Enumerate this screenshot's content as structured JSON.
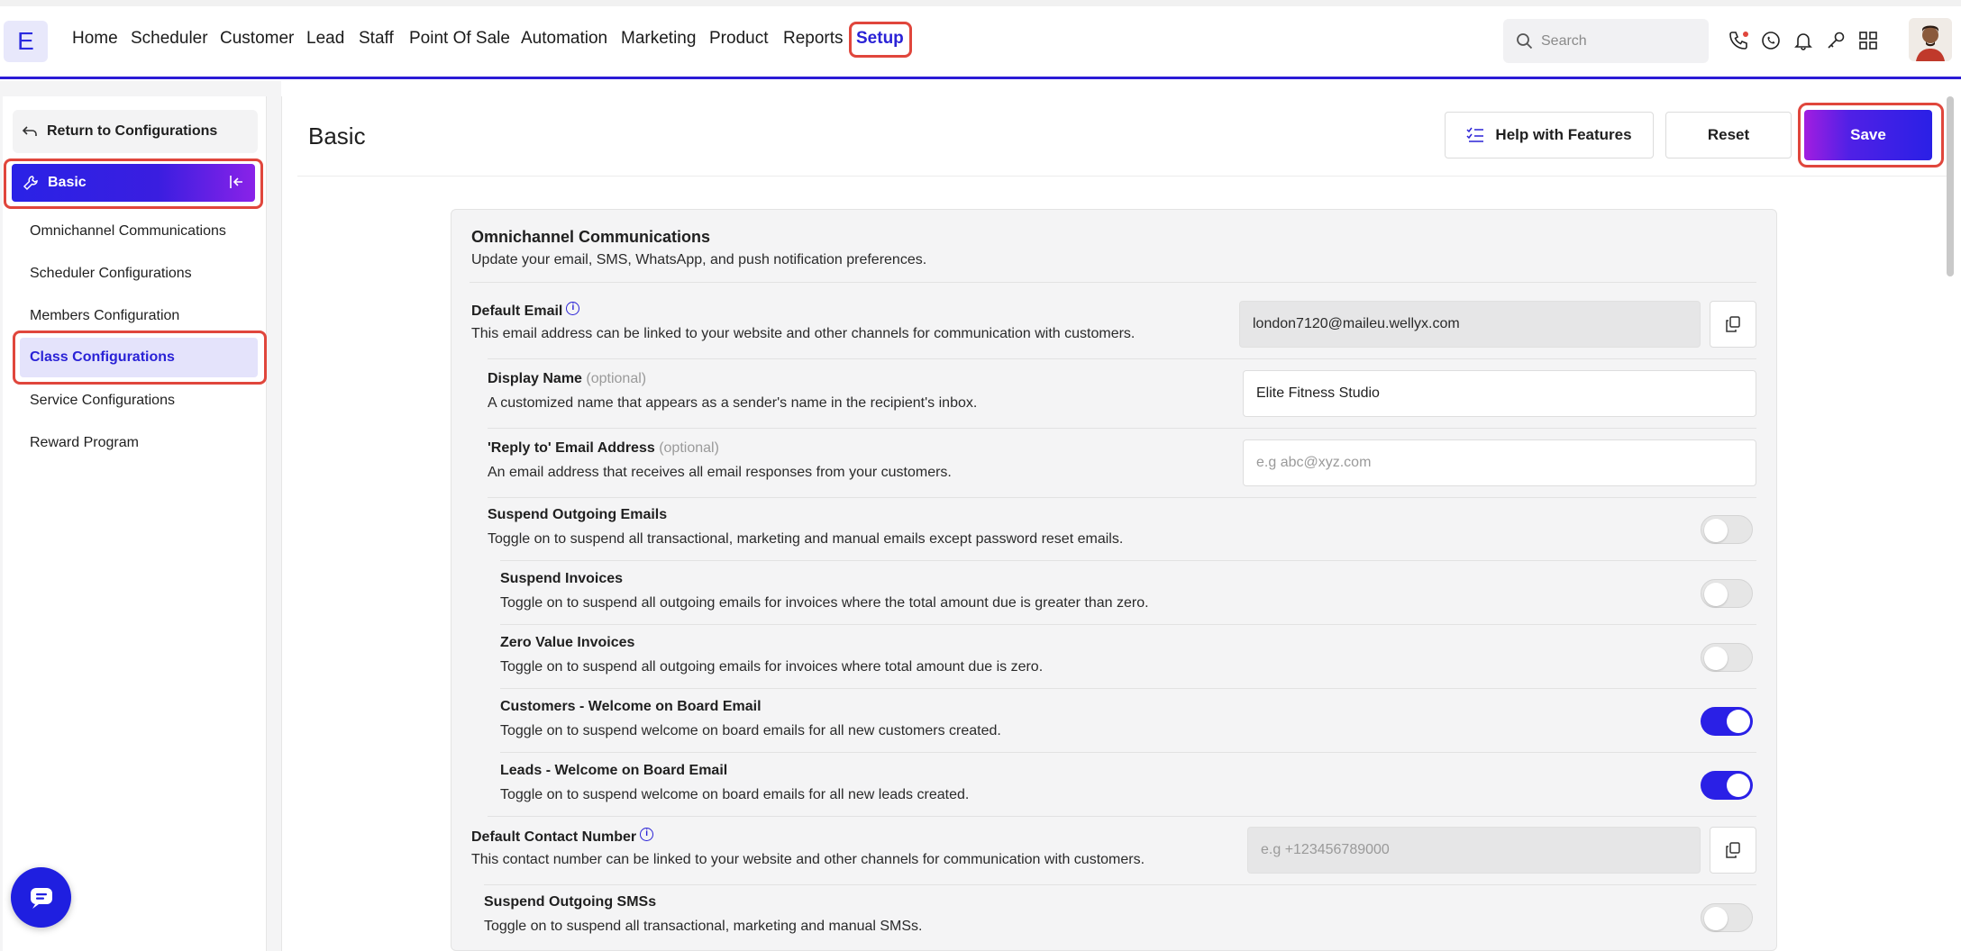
{
  "nav": {
    "logo": "E",
    "items": [
      "Home",
      "Scheduler",
      "Customer",
      "Lead",
      "Staff",
      "Point Of Sale",
      "Automation",
      "Marketing",
      "Product",
      "Reports",
      "Setup"
    ],
    "active": "Setup",
    "search_placeholder": "Search",
    "icons": [
      "phone-icon",
      "whatsapp-icon",
      "bell-icon",
      "key-icon",
      "grid-icon"
    ]
  },
  "sidebar": {
    "return_label": "Return to Configurations",
    "section_label": "Basic",
    "items": [
      "Omnichannel Communications",
      "Scheduler Configurations",
      "Members Configuration",
      "Class Configurations",
      "Service Configurations",
      "Reward Program"
    ],
    "selected_item": "Class Configurations"
  },
  "header": {
    "title": "Basic",
    "help_label": "Help with Features",
    "reset_label": "Reset",
    "save_label": "Save"
  },
  "card": {
    "title": "Omnichannel Communications",
    "subtitle": "Update your email, SMS, WhatsApp, and push notification preferences.",
    "default_email": {
      "title": "Default Email",
      "desc": "This email address can be linked to your website and other channels for communication with customers.",
      "value": "london7120@maileu.wellyx.com"
    },
    "display_name": {
      "title": "Display Name",
      "optional": "(optional)",
      "desc": "A customized name that appears as a sender's name in the recipient's inbox.",
      "value": "Elite Fitness Studio"
    },
    "reply_to": {
      "title": "'Reply to' Email Address",
      "optional": "(optional)",
      "desc": "An email address that receives all email responses from your customers.",
      "placeholder": "e.g abc@xyz.com"
    },
    "toggles": [
      {
        "title": "Suspend Outgoing Emails",
        "desc": "Toggle on to suspend all transactional, marketing and manual emails except password reset emails.",
        "on": false
      },
      {
        "title": "Suspend Invoices",
        "desc": "Toggle on to suspend all outgoing emails for invoices where the total amount due is greater than zero.",
        "on": false
      },
      {
        "title": "Zero Value Invoices",
        "desc": "Toggle on to suspend all outgoing emails for invoices where total amount due is zero.",
        "on": false
      },
      {
        "title": "Customers - Welcome on Board Email",
        "desc": "Toggle on to suspend welcome on board emails for all new customers created.",
        "on": true
      },
      {
        "title": "Leads - Welcome on Board Email",
        "desc": "Toggle on to suspend welcome on board emails for all new leads created.",
        "on": true
      }
    ],
    "default_contact": {
      "title": "Default Contact Number",
      "desc": "This contact number can be linked to your website and other channels for communication with customers.",
      "placeholder": "e.g +123456789000"
    },
    "suspend_sms": {
      "title": "Suspend Outgoing SMSs",
      "desc": "Toggle on to suspend all transactional, marketing and manual SMSs.",
      "on": false
    }
  },
  "colors": {
    "accent": "#2a22d6",
    "highlight_border": "#e0463c",
    "toggle_on": "#2a20e6"
  }
}
